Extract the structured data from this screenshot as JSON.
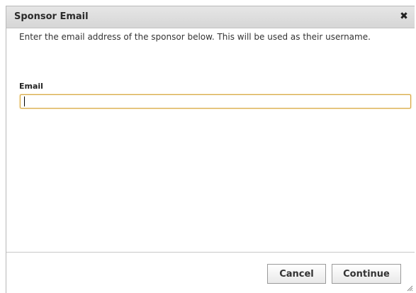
{
  "dialog": {
    "title": "Sponsor Email",
    "close_icon": "close-icon",
    "instructions": "Enter the email address of the sponsor below. This will be used as their username.",
    "email_label": "Email",
    "email_value": "",
    "cancel_label": "Cancel",
    "continue_label": "Continue",
    "resize_icon": "resize-grip-icon"
  },
  "colors": {
    "titlebar": "#dcdcdc",
    "input_focus_border": "#d4a640"
  }
}
